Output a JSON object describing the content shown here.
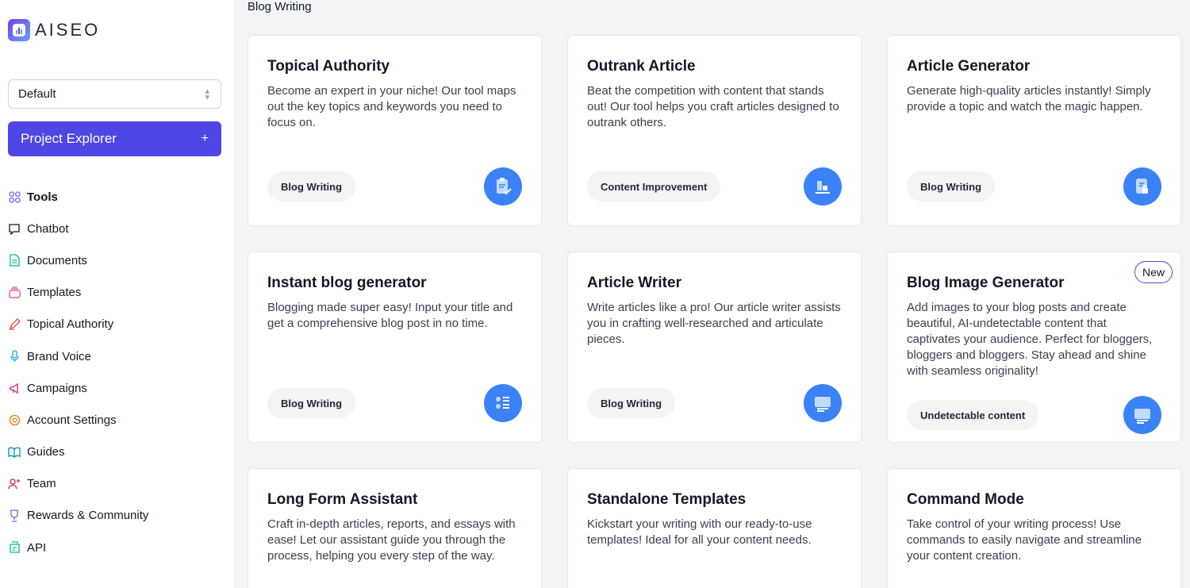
{
  "app": {
    "logo_text": "AISEO"
  },
  "sidebar": {
    "project_select": "Default",
    "project_explorer_label": "Project Explorer",
    "project_explorer_plus": "+",
    "items": [
      {
        "label": "Tools",
        "icon": "grid-icon",
        "color": "#6366f1"
      },
      {
        "label": "Chatbot",
        "icon": "chat-icon",
        "color": "#111827"
      },
      {
        "label": "Documents",
        "icon": "document-icon",
        "color": "#10b981"
      },
      {
        "label": "Templates",
        "icon": "templates-icon",
        "color": "#ec4899"
      },
      {
        "label": "Topical Authority",
        "icon": "pen-icon",
        "color": "#ef4444"
      },
      {
        "label": "Brand Voice",
        "icon": "microphone-icon",
        "color": "#0ea5e9"
      },
      {
        "label": "Campaigns",
        "icon": "megaphone-icon",
        "color": "#db2777"
      },
      {
        "label": "Account Settings",
        "icon": "gear-icon",
        "color": "#f97316"
      },
      {
        "label": "Guides",
        "icon": "book-icon",
        "color": "#0891b2"
      },
      {
        "label": "Team",
        "icon": "user-add-icon",
        "color": "#e11d48"
      },
      {
        "label": "Rewards & Community",
        "icon": "trophy-icon",
        "color": "#6366f1"
      },
      {
        "label": "API",
        "icon": "api-icon",
        "color": "#10b981"
      }
    ]
  },
  "main": {
    "section_title": "Blog Writing",
    "cards": [
      {
        "title": "Topical Authority",
        "description": "Become an expert in your niche! Our tool maps out the key topics and keywords you need to focus on.",
        "tag": "Blog Writing",
        "icon": "clipboard-check-icon"
      },
      {
        "title": "Outrank Article",
        "description": "Beat the competition with content that stands out! Our tool helps you craft articles designed to outrank others.",
        "tag": "Content Improvement",
        "icon": "rank-icon"
      },
      {
        "title": "Article Generator",
        "description": "Generate high-quality articles instantly! Simply provide a topic and watch the magic happen.",
        "tag": "Blog Writing",
        "icon": "document-lock-icon"
      },
      {
        "title": "Instant blog generator",
        "description": "Blogging made super easy! Input your title and get a comprehensive blog post in no time.",
        "tag": "Blog Writing",
        "icon": "list-icon"
      },
      {
        "title": "Article Writer",
        "description": "Write articles like a pro! Our article writer assists you in crafting well-researched and articulate pieces.",
        "tag": "Blog Writing",
        "icon": "monitor-icon"
      },
      {
        "title": "Blog Image Generator",
        "description": "Add images to your blog posts and create beautiful, AI-undetectable content that captivates your audience. Perfect for bloggers, bloggers and bloggers. Stay ahead and shine with seamless originality!",
        "tag": "Undetectable content",
        "icon": "monitor-icon",
        "badge": "New"
      },
      {
        "title": "Long Form Assistant",
        "description": "Craft in-depth articles, reports, and essays with ease! Let our assistant guide you through the process, helping you every step of the way."
      },
      {
        "title": "Standalone Templates",
        "description": "Kickstart your writing with our ready-to-use templates! Ideal for all your content needs."
      },
      {
        "title": "Command Mode",
        "description": "Take control of your writing process! Use commands to easily navigate and streamline your content creation."
      }
    ]
  }
}
